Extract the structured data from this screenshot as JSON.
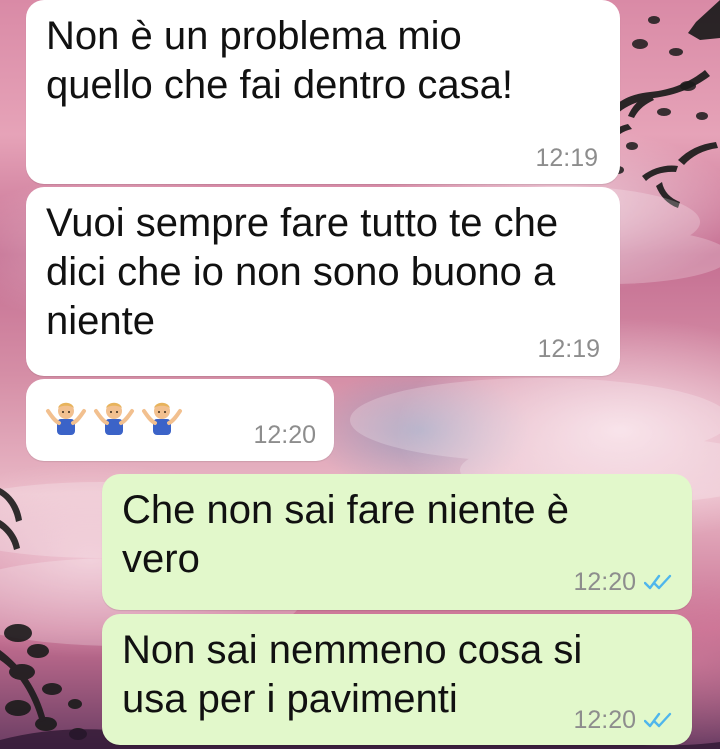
{
  "chat": {
    "messages": [
      {
        "direction": "incoming",
        "text": "Non è un problema mio\nquello che fai dentro casa!",
        "time": "12:19"
      },
      {
        "direction": "incoming",
        "text": "Vuoi sempre fare tutto te che\ndici che io non sono buono a\nniente",
        "time": "12:19"
      },
      {
        "direction": "incoming",
        "emoji": [
          "person-shrugging-icon",
          "person-shrugging-icon",
          "person-shrugging-icon"
        ],
        "time": "12:20"
      },
      {
        "direction": "outgoing",
        "text": "Che non sai fare niente è\nvero",
        "time": "12:20",
        "status_icon": "double-check-read-icon"
      },
      {
        "direction": "outgoing",
        "text": "Non sai nemmeno cosa si\nusa per i pavimenti",
        "time": "12:20",
        "status_icon": "double-check-read-icon"
      }
    ]
  },
  "colors": {
    "incoming_bubble": "#ffffff",
    "outgoing_bubble": "#e2f8cb",
    "timestamp": "#8d8d8d",
    "read_ticks": "#4fb6ec",
    "background_pink": "#d98aa6"
  }
}
